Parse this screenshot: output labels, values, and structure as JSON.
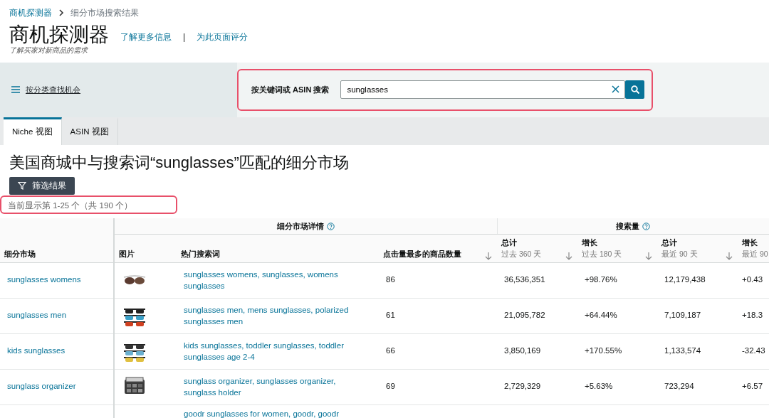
{
  "breadcrumb": [
    {
      "label": "商机探测器",
      "link": true
    },
    {
      "label": "细分市场搜索结果",
      "link": false
    }
  ],
  "header": {
    "title": "商机探测器",
    "links": [
      "了解更多信息",
      "为此页面评分"
    ],
    "separator": "|",
    "subtitle": "了解买家对新商品的需求"
  },
  "category_browse": {
    "label": "按分类查找机会"
  },
  "search": {
    "label": "按关键词或 ASIN 搜索",
    "value": "sunglasses",
    "highlighted": true
  },
  "tabs": [
    {
      "label": "Niche 视图",
      "selected": true
    },
    {
      "label": "ASIN 视图",
      "selected": false
    }
  ],
  "results_title": "美国商城中与搜索词“sunglasses”匹配的细分市场",
  "filter_button": "筛选结果",
  "results_count": {
    "text": "当前显示第 1-25 个（共 190 个）",
    "highlighted": true
  },
  "table": {
    "first_column": {
      "label": "细分市场"
    },
    "groups": [
      {
        "label": "细分市场详情",
        "columns": [
          {
            "label": "图片",
            "sortable": false
          },
          {
            "label": "热门搜索词",
            "sortable": false
          },
          {
            "label": "点击量最多的商品数量",
            "sortable": true
          }
        ]
      },
      {
        "label": "搜索量",
        "columns": [
          {
            "label": "总计",
            "sublabel": "过去 360 天",
            "sortable": true
          },
          {
            "label": "增长",
            "sublabel": "过去 180 天",
            "sortable": true
          },
          {
            "label": "总计",
            "sublabel": "最近 90 天",
            "sortable": true
          },
          {
            "label": "增长",
            "sublabel": "最近 90",
            "sortable": false
          }
        ]
      }
    ],
    "rows": [
      {
        "niche": "sunglasses womens",
        "keywords": "sunglasses womens, sunglasses, womens sunglasses",
        "cells": [
          "86",
          "36,536,351",
          "+98.76%",
          "12,179,438",
          "+0.43"
        ]
      },
      {
        "niche": "sunglasses men",
        "keywords": "sunglasses men, mens sunglasses, polarized sunglasses men",
        "cells": [
          "61",
          "21,095,782",
          "+64.44%",
          "7,109,187",
          "+18.3"
        ]
      },
      {
        "niche": "kids sunglasses",
        "keywords": "kids sunglasses, toddler sunglasses, toddler sunglasses age 2-4",
        "cells": [
          "66",
          "3,850,169",
          "+170.55%",
          "1,133,574",
          "-32.43"
        ]
      },
      {
        "niche": "sunglass organizer",
        "keywords": "sunglass organizer, sunglasses organizer, sunglass holder",
        "cells": [
          "69",
          "2,729,329",
          "+5.63%",
          "723,294",
          "+6.57"
        ]
      },
      {
        "keywords": "goodr sunglasses for women, goodr, goodr"
      }
    ]
  }
}
